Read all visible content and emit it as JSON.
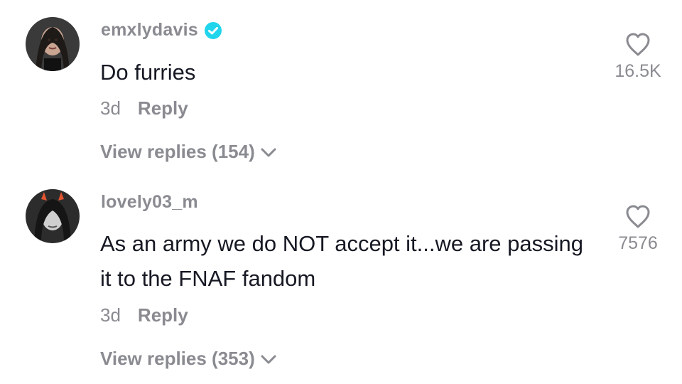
{
  "comments": [
    {
      "username": "emxlydavis",
      "verified": true,
      "text": "Do furries",
      "time": "3d",
      "reply_label": "Reply",
      "view_replies": "View replies (154)",
      "likes": "16.5K"
    },
    {
      "username": "lovely03_m",
      "verified": false,
      "text": "As an army we do NOT accept it...we are passing it to the FNAF fandom",
      "time": "3d",
      "reply_label": "Reply",
      "view_replies": "View replies (353)",
      "likes": "7576"
    }
  ],
  "colors": {
    "verified_badge": "#20d5ec",
    "secondary_text": "#8a8b91",
    "primary_text": "#161823"
  },
  "icons": [
    "verified-badge-icon",
    "heart-icon",
    "chevron-down-icon"
  ]
}
